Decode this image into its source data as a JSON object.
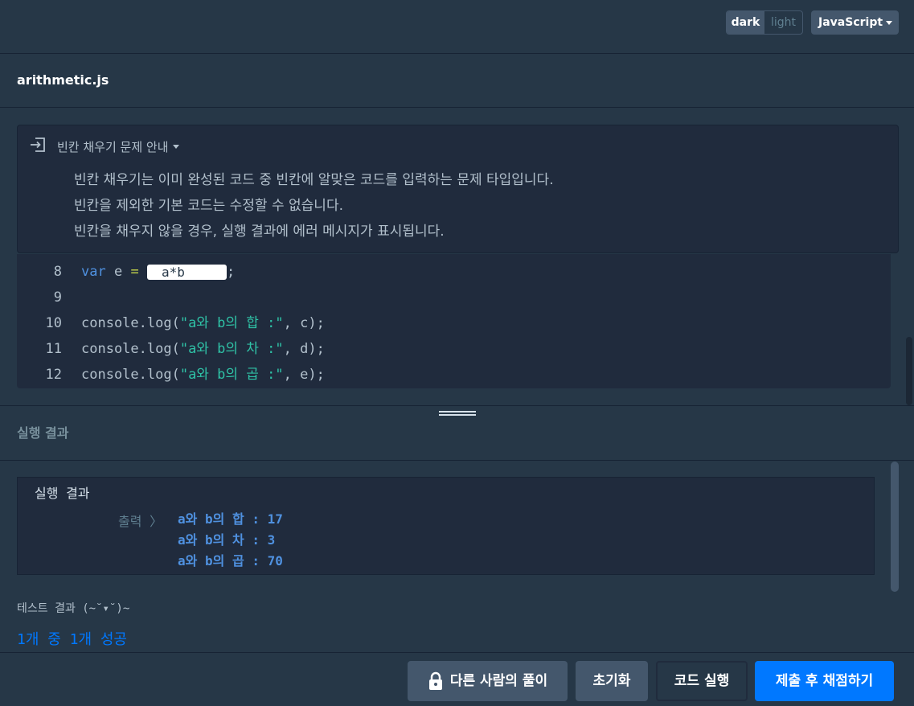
{
  "header": {
    "theme_dark": "dark",
    "theme_light": "light",
    "language": "JavaScript"
  },
  "file": {
    "name": "arithmetic.js"
  },
  "guide": {
    "title": "빈칸 채우기 문제 안내",
    "lines": [
      "빈칸 채우기는 이미 완성된 코드 중 빈칸에 알맞은 코드를 입력하는 문제 타입입니다.",
      "빈칸을 제외한 기본 코드는 수정할 수 없습니다.",
      "빈칸을 채우지 않을 경우, 실행 결과에 에러 메시지가 표시됩니다."
    ]
  },
  "code": {
    "line8": {
      "num": "8",
      "kw": "var",
      "ident": " e ",
      "op": "=",
      "space": " ",
      "blank_value": "a*b",
      "tail": ";"
    },
    "line9": {
      "num": "9"
    },
    "line10": {
      "num": "10",
      "call": "console.log(",
      "str": "\"a와 b의 합 :\"",
      "rest": ", c);"
    },
    "line11": {
      "num": "11",
      "call": "console.log(",
      "str": "\"a와 b의 차 :\"",
      "rest": ", d);"
    },
    "line12": {
      "num": "12",
      "call": "console.log(",
      "str": "\"a와 b의 곱 :\"",
      "rest": ", e);"
    }
  },
  "result": {
    "section_label": "실행 결과",
    "box_title": "실행 결과",
    "output_prefix": "출력 〉",
    "output_lines": [
      "a와 b의 합 : 17",
      "a와 b의 차 : 3",
      "a와 b의 곱 : 70"
    ],
    "test_label": "테스트 결과 (~˘▾˘)~",
    "test_summary": "1개 중 1개 성공"
  },
  "toolbar": {
    "others_label": "다른 사람의 풀이",
    "reset_label": "초기화",
    "run_label": "코드 실행",
    "submit_label": "제출 후 채점하기"
  },
  "colors": {
    "background": "#263747",
    "panel": "#202b3d",
    "accent": "#0078ff",
    "keyword": "#4f91e0",
    "string": "#2fc2a6"
  }
}
